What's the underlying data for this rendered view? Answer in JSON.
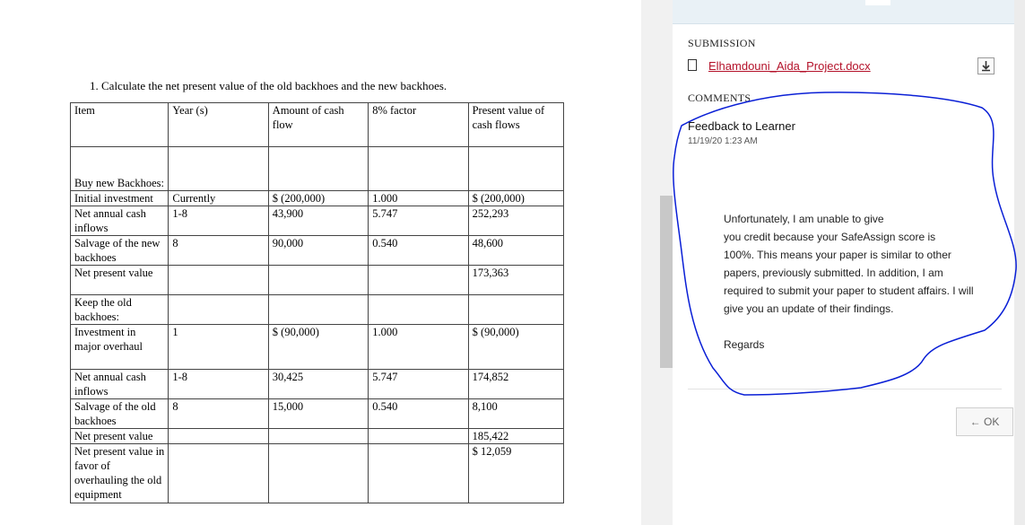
{
  "document": {
    "question": "1.  Calculate the net present value of the old backhoes and the new backhoes.",
    "table": {
      "headers": [
        "Item",
        "Year (s)",
        "Amount of cash flow",
        "8% factor",
        "Present value of cash flows"
      ],
      "rows": [
        {
          "item": "",
          "year": "",
          "amount": "",
          "factor": "",
          "pv": ""
        },
        {
          "item": "Buy new Backhoes:",
          "year": "",
          "amount": "",
          "factor": "",
          "pv": ""
        },
        {
          "item": "Initial investment",
          "year": "Currently",
          "amount": "$ (200,000)",
          "factor": "1.000",
          "pv": "$ (200,000)"
        },
        {
          "item": "Net annual cash inflows",
          "year": "1-8",
          "amount": "43,900",
          "factor": "5.747",
          "pv": "252,293"
        },
        {
          "item": "Salvage of the new backhoes",
          "year": "8",
          "amount": "90,000",
          "factor": "0.540",
          "pv": "48,600"
        },
        {
          "item": "Net present value",
          "year": "",
          "amount": "",
          "factor": "",
          "pv": "173,363"
        },
        {
          "item": "Keep the old backhoes:",
          "year": "",
          "amount": "",
          "factor": "",
          "pv": ""
        },
        {
          "item": "Investment in major overhaul",
          "year": "1",
          "amount": "$ (90,000)",
          "factor": "1.000",
          "pv": "$ (90,000)"
        },
        {
          "item": "Net annual cash inflows",
          "year": "1-8",
          "amount": "30,425",
          "factor": "5.747",
          "pv": "174,852"
        },
        {
          "item": "Salvage of the old backhoes",
          "year": "8",
          "amount": "15,000",
          "factor": "0.540",
          "pv": "8,100"
        },
        {
          "item": "Net present value",
          "year": "",
          "amount": "",
          "factor": "",
          "pv": "185,422"
        },
        {
          "item": "Net present value in favor of overhauling the old equipment",
          "year": "",
          "amount": "",
          "factor": "",
          "pv": "$ 12,059"
        }
      ]
    }
  },
  "panel": {
    "submission_heading": "SUBMISSION",
    "file_name": "Elhamdouni_Aida_Project.docx",
    "download_icon": "download-icon",
    "comments_heading": "COMMENTS",
    "feedback_title": "Feedback to Learner",
    "feedback_date": "11/19/20 1:23 AM",
    "feedback_lines": [
      "Unfortunately, I am unable to give",
      "you credit because your SafeAssign score is",
      "100%. This means your paper is similar to other",
      "papers, previously submitted.   In addition, I am",
      "required to submit your paper to student affairs. I will",
      "give you an update of their findings."
    ],
    "regards": "Regards",
    "ok_label": "← OK",
    "link_color": "#b4122a",
    "scribble_color": "#0a1fd6"
  }
}
